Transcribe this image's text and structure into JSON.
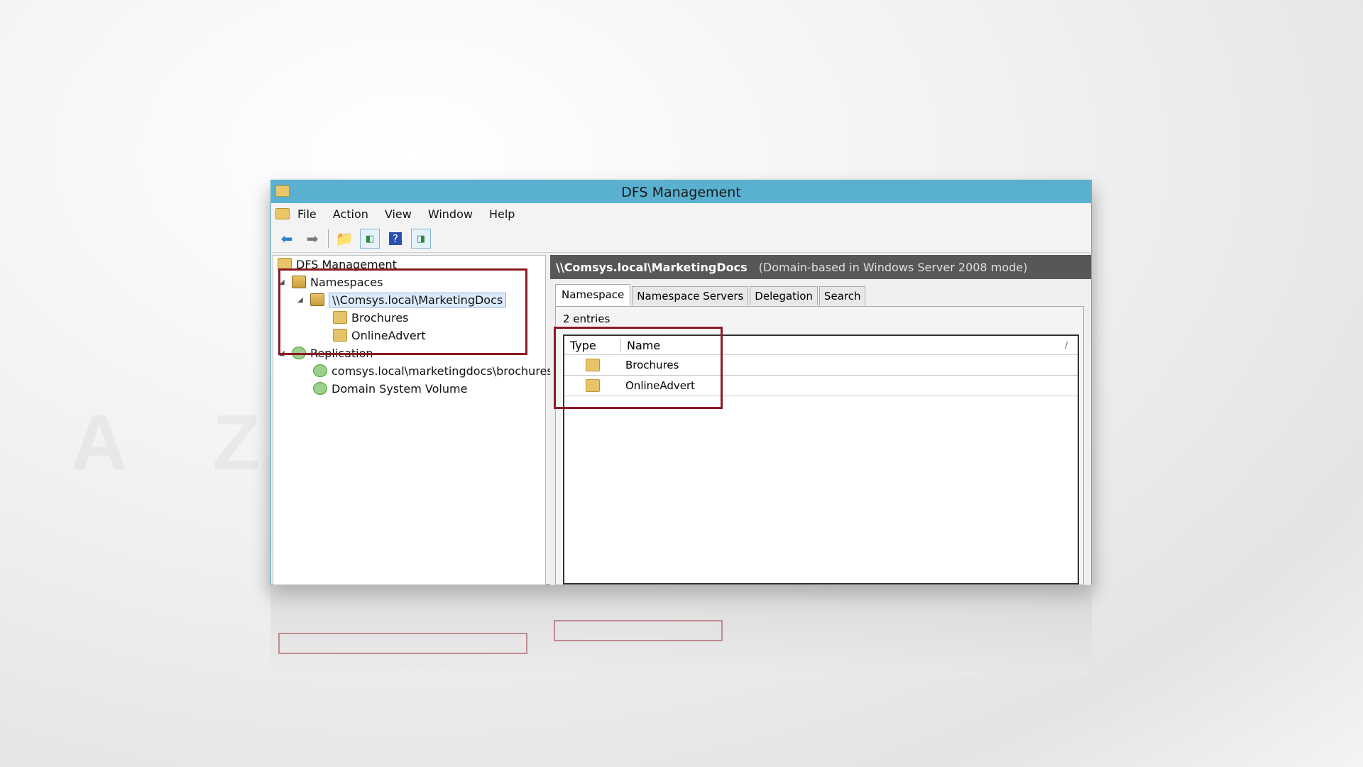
{
  "watermark": "AZARSYS",
  "window": {
    "title": "DFS Management"
  },
  "menu": [
    "File",
    "Action",
    "View",
    "Window",
    "Help"
  ],
  "toolbar": {
    "icons": [
      "back-arrow-icon",
      "forward-arrow-icon",
      "up-folder-icon",
      "show-hide-tree-icon",
      "help-icon",
      "show-hide-action-pane-icon"
    ]
  },
  "tree": {
    "root": "DFS Management",
    "namespaces": "Namespaces",
    "namespace": "\\\\Comsys.local\\MarketingDocs",
    "folders": [
      "Brochures",
      "OnlineAdvert"
    ],
    "replication": "Replication",
    "groups": [
      "comsys.local\\marketingdocs\\brochures",
      "Domain System Volume"
    ]
  },
  "details": {
    "path": "\\\\Comsys.local\\MarketingDocs",
    "mode": "(Domain-based in Windows Server 2008 mode)",
    "tabs": [
      "Namespace",
      "Namespace Servers",
      "Delegation",
      "Search"
    ],
    "entries": "2 entries",
    "columns": [
      "Type",
      "Name"
    ],
    "sort_indicator": "/",
    "rows": [
      {
        "name": "Brochures"
      },
      {
        "name": "OnlineAdvert"
      }
    ]
  },
  "colors": {
    "titlebar": "#5ab0cf",
    "highlight": "#8b1a22",
    "header": "#575757"
  }
}
